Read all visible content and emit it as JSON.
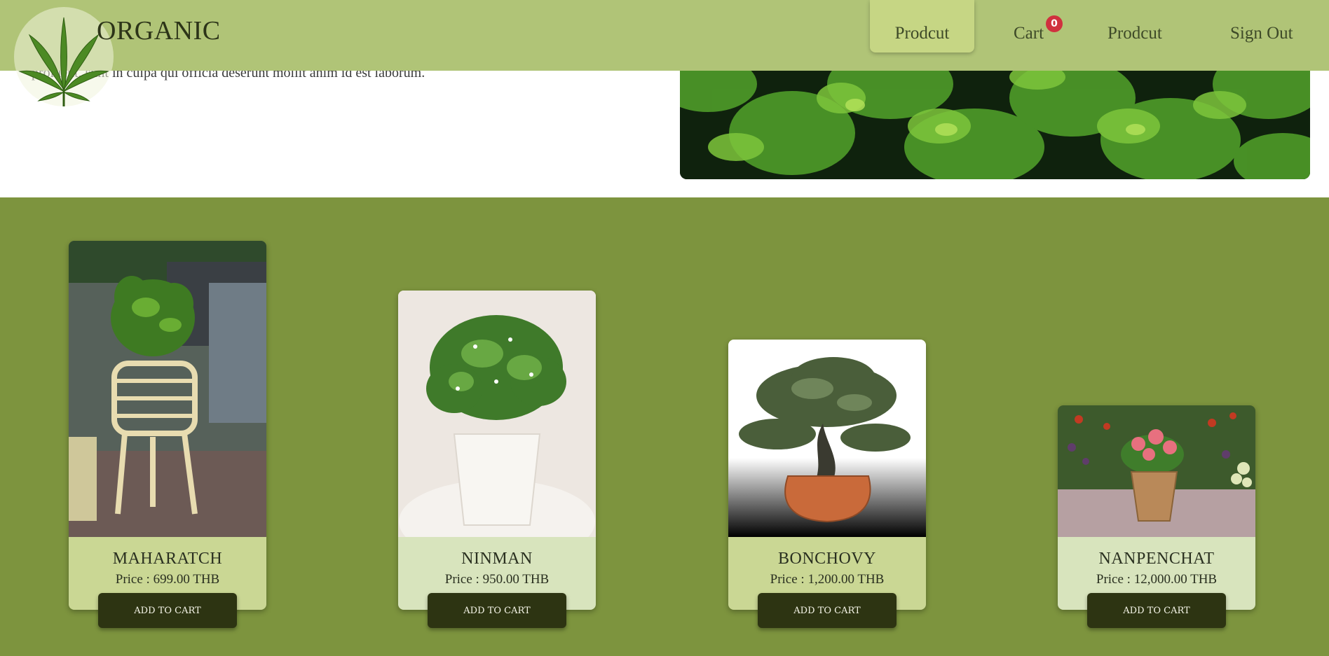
{
  "brand": {
    "name": "ORGANIC",
    "logo_icon": "cannabis-leaf-icon"
  },
  "nav": {
    "items": [
      {
        "label": "Prodcut",
        "active": true
      },
      {
        "label": "Cart"
      },
      {
        "label": "Prodcut"
      },
      {
        "label": "Sign Out"
      }
    ],
    "cart_count": "0"
  },
  "hero": {
    "text": "proident, sunt in culpa qui officia deserunt mollit anim id est laborum.",
    "image": "cannabis-leaves-photo"
  },
  "products": [
    {
      "name": "MAHARATCH",
      "price": "Price : 699.00 THB",
      "button": "ADD TO CART",
      "image": "zz-plant-rattan-stand-photo",
      "info_bg": "#cad794"
    },
    {
      "name": "NINMAN",
      "price": "Price : 950.00 THB",
      "button": "ADD TO CART",
      "image": "white-pot-shrub-photo",
      "info_bg": "#d8e4bd"
    },
    {
      "name": "BONCHOVY",
      "price": "Price : 1,200.00 THB",
      "button": "ADD TO CART",
      "image": "bonsai-tree-photo",
      "info_bg": "#cad794"
    },
    {
      "name": "NANPENCHAT",
      "price": "Price : 12,000.00 THB",
      "button": "ADD TO CART",
      "image": "pink-flower-pot-photo",
      "info_bg": "#d8e4bd"
    }
  ],
  "colors": {
    "header_bg": "#b0c477",
    "active_nav_bg": "#c6d684",
    "section_bg": "#7d943e",
    "button_bg": "#2d3412",
    "badge_bg": "#d0313e"
  }
}
